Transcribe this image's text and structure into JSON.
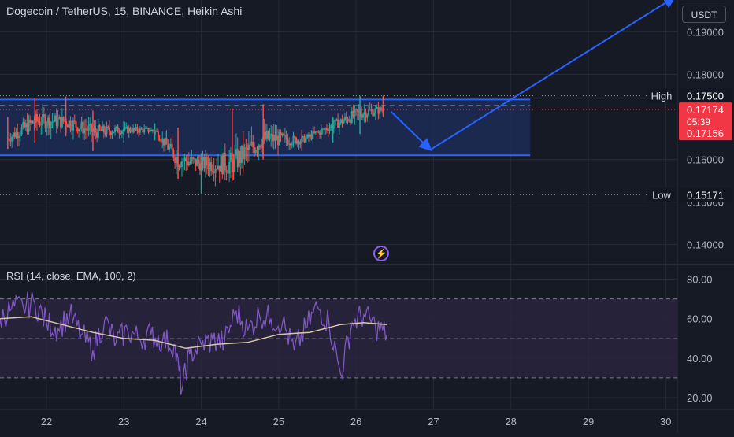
{
  "header": {
    "title": "Dogecoin / TetherUS, 15, BINANCE, Heikin Ashi",
    "currency_button": "USDT",
    "alert_icon": "lightning-icon"
  },
  "colors": {
    "background": "#161a25",
    "grid": "#262a36",
    "axis_text": "#b2b5be",
    "bull": "#26a69a",
    "bear": "#ef5350",
    "channel": "#2962ff",
    "channel_fill": "#1e2f5e",
    "rsi_line": "#7e57c2",
    "rsi_ma": "#d8c8a8",
    "rsi_band": "#2a2440",
    "price_tag": "#f23645",
    "marker_tag": "#131722"
  },
  "chart_data": [
    {
      "type": "candlestick",
      "title": "Dogecoin / TetherUS, 15, BINANCE, Heikin Ashi",
      "x_ticks": [
        "22",
        "23",
        "24",
        "25",
        "26",
        "27",
        "28",
        "29",
        "30"
      ],
      "x_range": [
        21.4,
        30.15
      ],
      "y_ticks": [
        "0.19000",
        "0.18000",
        "0.16000",
        "0.15000",
        "0.14000"
      ],
      "y_range": [
        0.1355,
        0.1975
      ],
      "grid": true,
      "markers": [
        {
          "label": "High",
          "value": "0.17500"
        },
        {
          "label": "Low",
          "value": "0.15171"
        }
      ],
      "last_price": {
        "value": "0.17174",
        "countdown": "05:39",
        "value2": "0.17156"
      },
      "channel": {
        "top": 0.1741,
        "mid": 0.1728,
        "bottom": 0.161,
        "x_start": 21.4,
        "x_end": 28.25
      },
      "arrows": [
        {
          "from": [
            26.45,
            0.1713
          ],
          "to": [
            26.95,
            0.1625
          ]
        },
        {
          "from": [
            26.95,
            0.1622
          ],
          "to": [
            30.1,
            0.198
          ]
        }
      ],
      "candles_summary": [
        {
          "day": 21.5,
          "low": 0.1625,
          "high": 0.17,
          "close": 0.165
        },
        {
          "day": 21.85,
          "low": 0.164,
          "high": 0.1745,
          "close": 0.169
        },
        {
          "day": 22.25,
          "low": 0.1655,
          "high": 0.1748,
          "close": 0.169
        },
        {
          "day": 22.6,
          "low": 0.162,
          "high": 0.1715,
          "close": 0.1665
        },
        {
          "day": 23.0,
          "low": 0.164,
          "high": 0.169,
          "close": 0.167
        },
        {
          "day": 23.4,
          "low": 0.1645,
          "high": 0.1685,
          "close": 0.1668
        },
        {
          "day": 23.7,
          "low": 0.1555,
          "high": 0.1675,
          "close": 0.16
        },
        {
          "day": 24.0,
          "low": 0.152,
          "high": 0.1615,
          "close": 0.159
        },
        {
          "day": 24.4,
          "low": 0.155,
          "high": 0.172,
          "close": 0.159
        },
        {
          "day": 24.8,
          "low": 0.16,
          "high": 0.173,
          "close": 0.165
        },
        {
          "day": 25.3,
          "low": 0.162,
          "high": 0.167,
          "close": 0.1645
        },
        {
          "day": 25.7,
          "low": 0.164,
          "high": 0.17,
          "close": 0.168
        },
        {
          "day": 26.05,
          "low": 0.166,
          "high": 0.175,
          "close": 0.171
        },
        {
          "day": 26.35,
          "low": 0.17,
          "high": 0.175,
          "close": 0.1717
        }
      ]
    },
    {
      "type": "line",
      "title": "RSI (14, close, EMA, 100, 2)",
      "y_ticks": [
        "80.00",
        "60.00",
        "40.00",
        "20.00"
      ],
      "y_range": [
        14,
        87
      ],
      "bands": [
        70,
        50,
        30
      ],
      "x_ticks": [
        "22",
        "23",
        "24",
        "25",
        "26",
        "27",
        "28",
        "29",
        "30"
      ],
      "series": [
        {
          "x": [
            21.4,
            21.55,
            21.7,
            21.85,
            22.0,
            22.15,
            22.3,
            22.45,
            22.6,
            22.75,
            22.9,
            23.05,
            23.2,
            23.35,
            23.5,
            23.65,
            23.75,
            23.85,
            24.0,
            24.15,
            24.3,
            24.45,
            24.6,
            24.75,
            24.9,
            25.05,
            25.2,
            25.35,
            25.5,
            25.65,
            25.8,
            25.95,
            26.1,
            26.25,
            26.4
          ],
          "y": [
            60,
            65,
            66,
            68,
            58,
            55,
            62,
            52,
            44,
            59,
            48,
            54,
            50,
            52,
            49,
            47,
            24,
            42,
            47,
            49,
            48,
            64,
            54,
            62,
            60,
            58,
            44,
            55,
            66,
            58,
            32,
            58,
            62,
            56,
            52
          ]
        },
        {
          "x": [
            21.4,
            21.8,
            22.2,
            22.6,
            23.0,
            23.4,
            23.8,
            24.2,
            24.6,
            25.0,
            25.4,
            25.8,
            26.1,
            26.4
          ],
          "y": [
            60,
            61,
            57,
            53,
            50,
            49,
            45,
            47,
            48,
            52,
            53,
            57,
            58,
            57
          ]
        }
      ]
    }
  ]
}
